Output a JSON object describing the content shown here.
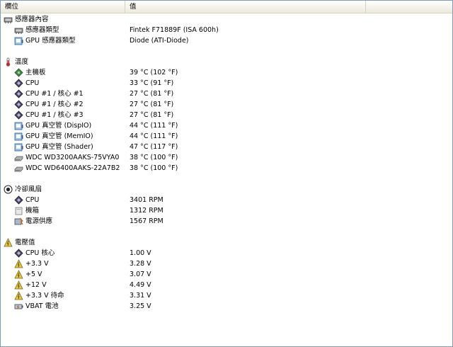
{
  "header": {
    "col_field": "欄位",
    "col_value": "值"
  },
  "sections": [
    {
      "title": "感應器內容",
      "icon": "sensor-chip-icon",
      "rows": [
        {
          "label": "感應器類型",
          "value": "Fintek F71889F  (ISA 600h)",
          "icon": "sensor-chip-icon"
        },
        {
          "label": "GPU 感應器類型",
          "value": "Diode  (ATI-Diode)",
          "icon": "gpu-card-icon"
        }
      ]
    },
    {
      "title": "溫度",
      "icon": "thermometer-icon",
      "rows": [
        {
          "label": "主機板",
          "value": "39 °C  (102 °F)",
          "icon": "motherboard-icon"
        },
        {
          "label": "CPU",
          "value": "33 °C  (91 °F)",
          "icon": "cpu-chip-icon"
        },
        {
          "label": "CPU #1 / 核心 #1",
          "value": "27 °C  (81 °F)",
          "icon": "cpu-chip-icon"
        },
        {
          "label": "CPU #1 / 核心 #2",
          "value": "27 °C  (81 °F)",
          "icon": "cpu-chip-icon"
        },
        {
          "label": "CPU #1 / 核心 #3",
          "value": "27 °C  (81 °F)",
          "icon": "cpu-chip-icon"
        },
        {
          "label": "GPU 真空管 (DispIO)",
          "value": "44 °C  (111 °F)",
          "icon": "gpu-card-icon"
        },
        {
          "label": "GPU 真空管 (MemIO)",
          "value": "44 °C  (111 °F)",
          "icon": "gpu-card-icon"
        },
        {
          "label": "GPU 真空管 (Shader)",
          "value": "47 °C  (117 °F)",
          "icon": "gpu-card-icon"
        },
        {
          "label": "WDC WD3200AAKS-75VYA0",
          "value": "38 °C  (100 °F)",
          "icon": "hard-drive-icon"
        },
        {
          "label": "WDC WD6400AAKS-22A7B2",
          "value": "38 °C  (100 °F)",
          "icon": "hard-drive-icon"
        }
      ]
    },
    {
      "title": "冷卻風扇",
      "icon": "fan-icon",
      "rows": [
        {
          "label": "CPU",
          "value": "3401 RPM",
          "icon": "cpu-chip-icon"
        },
        {
          "label": "機箱",
          "value": "1312 RPM",
          "icon": "chassis-icon"
        },
        {
          "label": "電源供應",
          "value": "1567 RPM",
          "icon": "power-supply-icon"
        }
      ]
    },
    {
      "title": "電壓值",
      "icon": "voltage-warning-icon",
      "rows": [
        {
          "label": "CPU 核心",
          "value": "1.00 V",
          "icon": "cpu-chip-icon"
        },
        {
          "label": "+3.3 V",
          "value": "3.28 V",
          "icon": "voltage-warning-icon"
        },
        {
          "label": "+5 V",
          "value": "3.07 V",
          "icon": "voltage-warning-icon"
        },
        {
          "label": "+12 V",
          "value": "4.49 V",
          "icon": "voltage-warning-icon"
        },
        {
          "label": "+3.3 V 待命",
          "value": "3.31 V",
          "icon": "voltage-warning-icon"
        },
        {
          "label": "VBAT 電池",
          "value": "3.25 V",
          "icon": "battery-icon"
        }
      ]
    }
  ]
}
